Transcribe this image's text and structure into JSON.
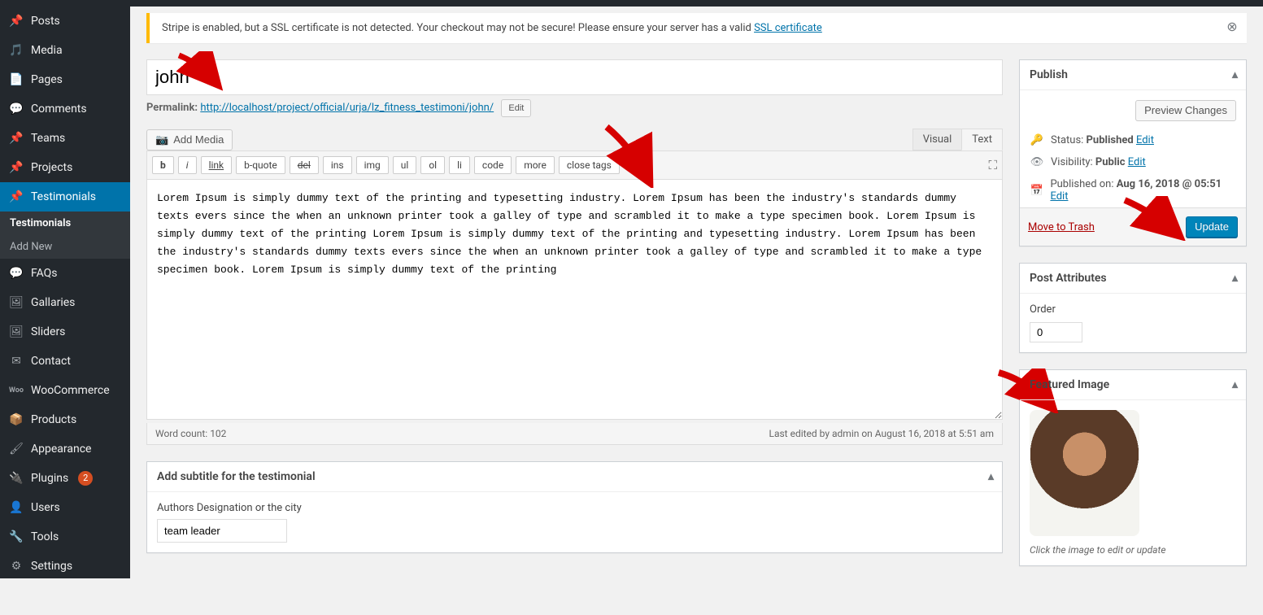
{
  "notice": {
    "text_pre": "Stripe is enabled, but a SSL certificate is not detected. Your checkout may not be secure! Please ensure your server has a valid ",
    "link": "SSL certificate"
  },
  "sidebar": {
    "items": [
      {
        "label": "Posts"
      },
      {
        "label": "Media"
      },
      {
        "label": "Pages"
      },
      {
        "label": "Comments"
      },
      {
        "label": "Teams"
      },
      {
        "label": "Projects"
      },
      {
        "label": "Testimonials"
      },
      {
        "label": "FAQs"
      },
      {
        "label": "Gallaries"
      },
      {
        "label": "Sliders"
      },
      {
        "label": "Contact"
      },
      {
        "label": "WooCommerce"
      },
      {
        "label": "Products"
      },
      {
        "label": "Appearance"
      },
      {
        "label": "Plugins"
      },
      {
        "label": "Users"
      },
      {
        "label": "Tools"
      },
      {
        "label": "Settings"
      }
    ],
    "sub": {
      "all": "Testimonials",
      "add": "Add New"
    },
    "plugins_updates": "2"
  },
  "title": "john",
  "permalink": {
    "label": "Permalink: ",
    "url": "http://localhost/project/official/urja/lz_fitness_testimoni/john/",
    "edit": "Edit"
  },
  "editor": {
    "add_media": "Add Media",
    "tabs": {
      "visual": "Visual",
      "text": "Text"
    },
    "buttons": [
      "b",
      "i",
      "link",
      "b-quote",
      "del",
      "ins",
      "img",
      "ul",
      "ol",
      "li",
      "code",
      "more",
      "close tags"
    ],
    "content": "Lorem Ipsum is simply dummy text of the printing and typesetting industry. Lorem Ipsum has been the industry's standards dummy texts evers since the when an unknown printer took a galley of type and scrambled it to make a type specimen book. Lorem Ipsum is simply dummy text of the printing Lorem Ipsum is simply dummy text of the printing and typesetting industry. Lorem Ipsum has been the industry's standards dummy texts evers since the when an unknown printer took a galley of type and scrambled it to make a type specimen book. Lorem Ipsum is simply dummy text of the printing",
    "word_count_label": "Word count: ",
    "word_count": "102",
    "last_edit": "Last edited by admin on August 16, 2018 at 5:51 am"
  },
  "subtitle_box": {
    "title": "Add subtitle for the testimonial",
    "field_label": "Authors Designation or the city",
    "value": "team leader"
  },
  "publish": {
    "title": "Publish",
    "preview": "Preview Changes",
    "status": {
      "label": "Status: ",
      "value": "Published",
      "edit": "Edit"
    },
    "visibility": {
      "label": "Visibility: ",
      "value": "Public",
      "edit": "Edit"
    },
    "date": {
      "label": "Published on: ",
      "value": "Aug 16, 2018 @ 05:51",
      "edit": "Edit"
    },
    "trash": "Move to Trash",
    "update": "Update"
  },
  "attrs": {
    "title": "Post Attributes",
    "order_label": "Order",
    "order_value": "0"
  },
  "featured": {
    "title": "Featured Image",
    "hint": "Click the image to edit or update"
  }
}
